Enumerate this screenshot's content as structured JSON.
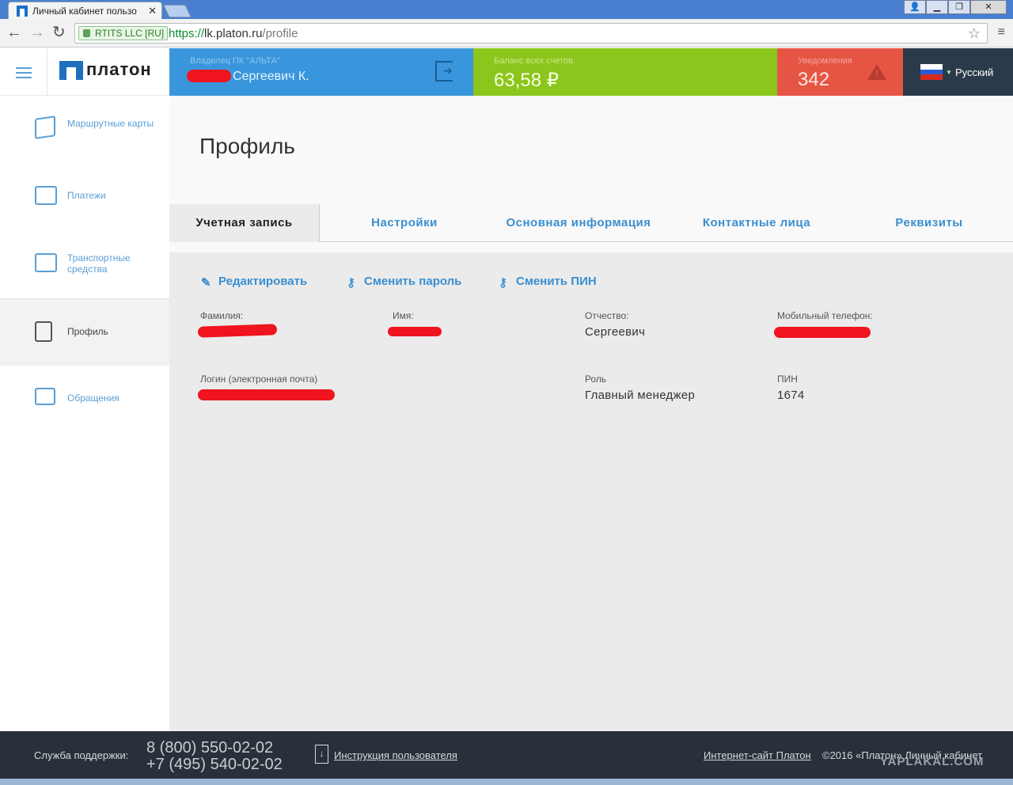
{
  "browser": {
    "tab_title": "Личный кабинет пользо",
    "tab_close": "✕",
    "cert_label": "RTITS LLC [RU]",
    "url_scheme": "https://",
    "url_host": "lk.platon.ru",
    "url_path": "/profile",
    "back_icon": "←",
    "forward_icon": "→",
    "reload_icon": "↻",
    "star_icon": "☆",
    "menu_icon": "≡",
    "win_user": "👤",
    "win_min": "▁",
    "win_max": "❐",
    "win_close": "✕"
  },
  "header": {
    "logo_text": "платон",
    "owner_label": "Владелец ПК \"АЛЬТА\"",
    "owner_name": "Сергеевич К.",
    "balance_label": "Баланс всех счетов:",
    "balance_value": "63,58 ₽",
    "notifications_label": "Уведомления",
    "notifications_count": "342",
    "language": "Русский",
    "lang_caret": "▼"
  },
  "sidebar": {
    "items": [
      {
        "label": "Маршрутные карты"
      },
      {
        "label": "Платежи"
      },
      {
        "label": "Транспортные средства"
      },
      {
        "label": "Профиль"
      },
      {
        "label": "Обращения"
      }
    ]
  },
  "page": {
    "title": "Профиль",
    "tabs": [
      {
        "label": "Учетная запись"
      },
      {
        "label": "Настройки"
      },
      {
        "label": "Основная информация"
      },
      {
        "label": "Контактные лица"
      },
      {
        "label": "Реквизиты"
      }
    ],
    "actions": {
      "edit": "Редактировать",
      "change_password": "Сменить пароль",
      "change_pin": "Сменить ПИН",
      "edit_icon": "✎",
      "key_icon": "⚷"
    },
    "fields": {
      "surname_label": "Фамилия:",
      "name_label": "Имя:",
      "patronymic_label": "Отчество:",
      "patronymic_value": "Сергеевич",
      "mobile_label": "Мобильный телефон:",
      "login_label": "Логин (электронная почта)",
      "role_label": "Роль",
      "role_value": "Главный менеджер",
      "pin_label": "ПИН",
      "pin_value": "1674"
    }
  },
  "footer": {
    "support_label": "Служба поддержки:",
    "phone1": "8 (800) 550-02-02",
    "phone2": "+7 (495) 540-02-02",
    "manual_link": "Инструкция пользователя",
    "download_icon": "↓",
    "site_link": "Интернет-сайт Платон",
    "copyright": "©2016 «Платон» Личный кабинет",
    "watermark": "YAPLAKAL.COM"
  },
  "colors": {
    "owner_bg": "#3a96dc",
    "balance_bg": "#8cc61c",
    "notifications_bg": "#e65544",
    "lang_bg": "#2b3a4a",
    "accent": "#3a8fd0",
    "redaction": "#f0141e"
  }
}
